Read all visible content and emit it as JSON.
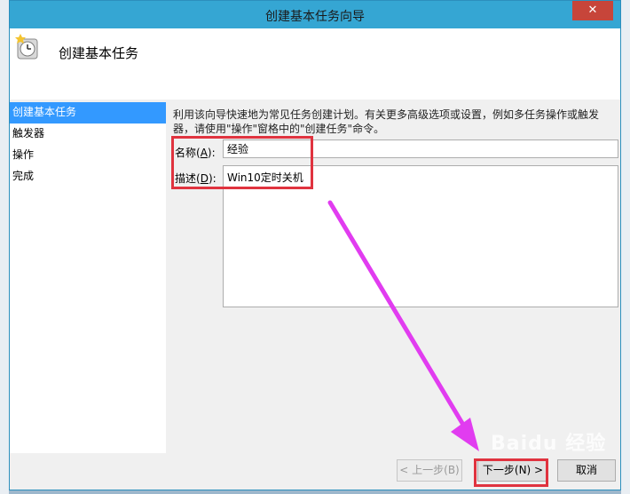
{
  "window": {
    "title": "创建基本任务向导"
  },
  "header": {
    "title": "创建基本任务"
  },
  "sidebar": {
    "items": [
      {
        "label": "创建基本任务",
        "active": true
      },
      {
        "label": "触发器",
        "active": false
      },
      {
        "label": "操作",
        "active": false
      },
      {
        "label": "完成",
        "active": false
      }
    ]
  },
  "main": {
    "intro_text": "利用该向导快速地为常见任务创建计划。有关更多高级选项或设置，例如多任务操作或触发器，请使用\"操作\"窗格中的\"创建任务\"命令。",
    "name_label_prefix": "名称(",
    "name_label_key": "A",
    "name_label_suffix": "):",
    "name_value": "经验",
    "desc_label_prefix": "描述(",
    "desc_label_key": "D",
    "desc_label_suffix": "):",
    "desc_value": "Win10定时关机"
  },
  "footer": {
    "back_label": "< 上一步(B)",
    "next_label": "下一步(N) >",
    "cancel_label": "取消"
  },
  "watermark": "Baidu 经验",
  "colors": {
    "titlebar": "#35a6d3",
    "close": "#c7453a",
    "highlight": "#e0333f",
    "arrow": "#e13cf0",
    "selection": "#3399ff"
  }
}
